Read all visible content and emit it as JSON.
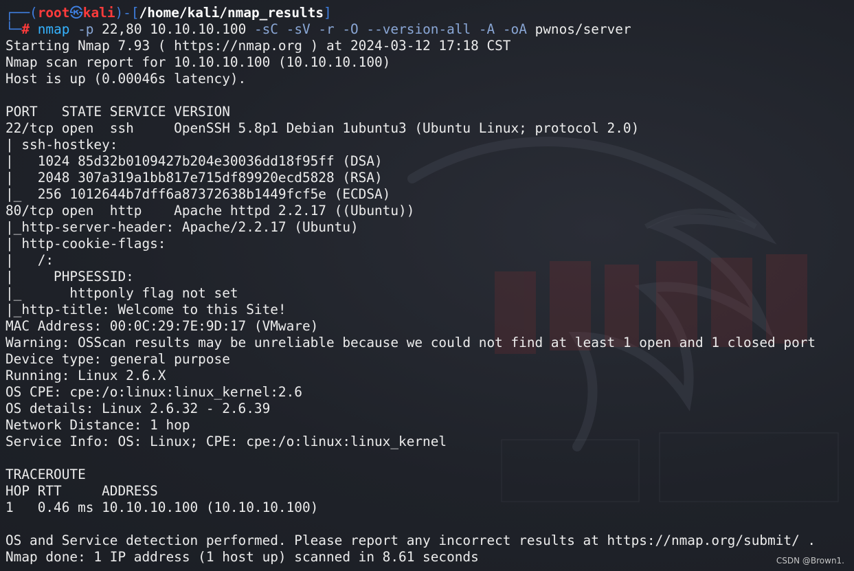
{
  "prompt": {
    "frame_top": "┌──(",
    "user": "root",
    "skull": "㉿",
    "host": "kali",
    "sep": ")-[",
    "path": "/home/kali/nmap_results",
    "close": "]",
    "frame_bottom": "└─",
    "hash": "#"
  },
  "command": {
    "exe": "nmap",
    "parts": [
      {
        "kind": "opt",
        "text": " -p"
      },
      {
        "kind": "arg",
        "text": " 22,80 10.10.10.100"
      },
      {
        "kind": "opt",
        "text": " -sC -sV -r -O --version-all -A -oA"
      },
      {
        "kind": "arg",
        "text": " pwnos/server"
      }
    ]
  },
  "output_lines": [
    "Starting Nmap 7.93 ( https://nmap.org ) at 2024-03-12 17:18 CST",
    "Nmap scan report for 10.10.10.100 (10.10.10.100)",
    "Host is up (0.00046s latency).",
    "",
    "PORT   STATE SERVICE VERSION",
    "22/tcp open  ssh     OpenSSH 5.8p1 Debian 1ubuntu3 (Ubuntu Linux; protocol 2.0)",
    "| ssh-hostkey: ",
    "|   1024 85d32b0109427b204e30036dd18f95ff (DSA)",
    "|   2048 307a319a1bb817e715df89920ecd5828 (RSA)",
    "|_  256 1012644b7dff6a87372638b1449fcf5e (ECDSA)",
    "80/tcp open  http    Apache httpd 2.2.17 ((Ubuntu))",
    "|_http-server-header: Apache/2.2.17 (Ubuntu)",
    "| http-cookie-flags: ",
    "|   /: ",
    "|     PHPSESSID: ",
    "|_      httponly flag not set",
    "|_http-title: Welcome to this Site!",
    "MAC Address: 00:0C:29:7E:9D:17 (VMware)",
    "Warning: OSScan results may be unreliable because we could not find at least 1 open and 1 closed port",
    "Device type: general purpose",
    "Running: Linux 2.6.X",
    "OS CPE: cpe:/o:linux:linux_kernel:2.6",
    "OS details: Linux 2.6.32 - 2.6.39",
    "Network Distance: 1 hop",
    "Service Info: OS: Linux; CPE: cpe:/o:linux:linux_kernel",
    "",
    "TRACEROUTE",
    "HOP RTT     ADDRESS",
    "1   0.46 ms 10.10.10.100 (10.10.10.100)",
    "",
    "OS and Service detection performed. Please report any incorrect results at https://nmap.org/submit/ .",
    "Nmap done: 1 IP address (1 host up) scanned in 8.61 seconds"
  ],
  "watermark": "CSDN @Brown1.",
  "colors": {
    "background": "#1f2229",
    "text": "#ececec",
    "prompt_red": "#ff3b3b",
    "prompt_blue": "#3f7fe0",
    "command_blue": "#35b3ff"
  }
}
